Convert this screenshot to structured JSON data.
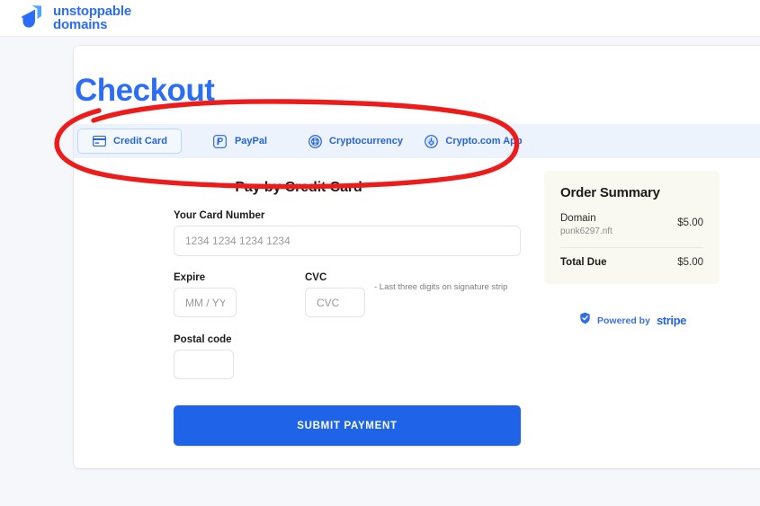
{
  "header": {
    "brand_line1": "unstoppable",
    "brand_line2": "domains",
    "logo_icon": "unstoppable-domains-logo"
  },
  "checkout": {
    "title": "Checkout",
    "pay_heading": "Pay by Credit Card",
    "tabs": [
      {
        "label": "Credit Card",
        "icon": "credit-card-icon",
        "selected": true
      },
      {
        "label": "PayPal",
        "icon": "paypal-icon",
        "selected": false
      },
      {
        "label": "Cryptocurrency",
        "icon": "cryptocurrency-icon",
        "selected": false
      },
      {
        "label": "Crypto.com App",
        "icon": "crypto-com-icon",
        "selected": false
      }
    ],
    "form": {
      "card_number_label": "Your Card Number",
      "card_number_value": "",
      "card_number_placeholder": "1234 1234 1234 1234",
      "expire_label": "Expire",
      "expire_value": "",
      "expire_placeholder": "MM / YY",
      "cvc_label": "CVC",
      "cvc_value": "",
      "cvc_placeholder": "CVC",
      "cvc_hint": "- Last three digits on signature strip",
      "postal_label": "Postal code",
      "postal_value": "",
      "postal_placeholder": "",
      "submit_label": "SUBMIT PAYMENT"
    }
  },
  "order_summary": {
    "title": "Order Summary",
    "item_label": "Domain",
    "item_name": "punk6297.nft",
    "item_amount": "$5.00",
    "total_label": "Total Due",
    "total_amount": "$5.00"
  },
  "stripe": {
    "shield_icon": "shield-check-icon",
    "powered_by": "Powered by",
    "brand": "stripe"
  },
  "annotation": {
    "shape": "hand-drawn-red-ellipse",
    "color": "#ee1b1b",
    "target": "payment-method-tabs"
  },
  "colors": {
    "brand_blue": "#2b6df6",
    "submit_blue": "#1f64e8",
    "tab_strip_bg": "#edf3fd",
    "summary_bg": "#faf9f1",
    "page_bg": "#f6f7fb",
    "annotation_red": "#ee1b1b"
  }
}
